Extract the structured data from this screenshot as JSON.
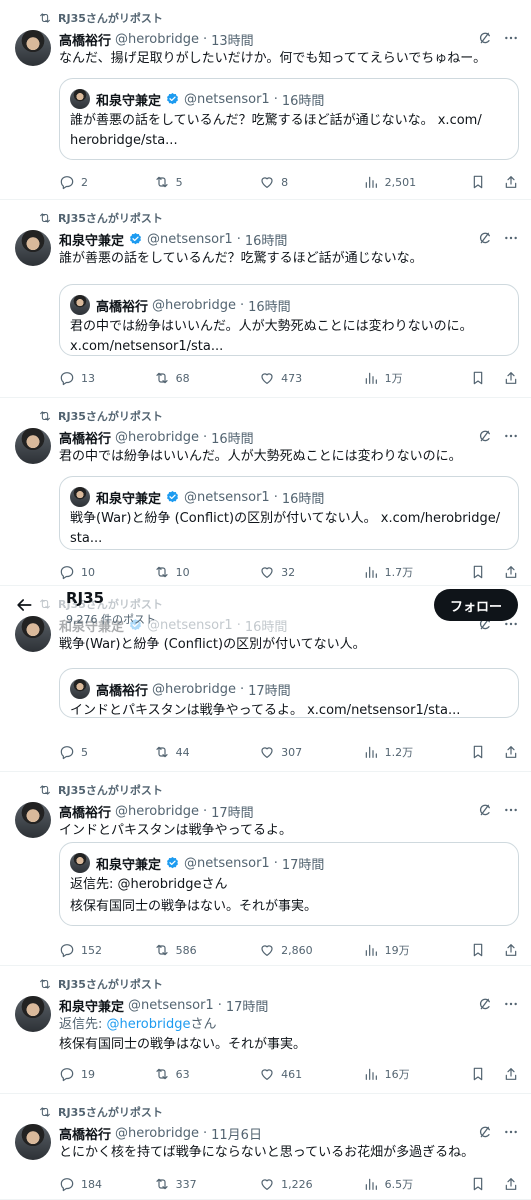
{
  "overlay": {
    "title": "RJ35",
    "post_count": "9,276 件のポスト",
    "follow_label": "フォロー"
  },
  "repost_label": "RJ35さんがリポスト",
  "tweets": [
    {
      "name": "高橋裕行",
      "handle": "@herobridge",
      "time": "13時間",
      "text": "なんだ、揚げ足取りがしたいだけか。何でも知っててえらいでちゅねー。",
      "quote": {
        "name": "和泉守兼定",
        "verified": true,
        "handle": "@netsensor1",
        "time": "16時間",
        "text1": "誰が善悪の話をしているんだ？吃驚するほど話が通じないな。 x.com/",
        "text2": "herobridge/sta..."
      },
      "replies": "2",
      "reposts": "5",
      "likes": "8",
      "views": "2,501"
    },
    {
      "name": "和泉守兼定",
      "verified": true,
      "handle": "@netsensor1",
      "time": "16時間",
      "text": "誰が善悪の話をしているんだ？吃驚するほど話が通じないな。",
      "quote": {
        "name": "高橋裕行",
        "handle": "@herobridge",
        "time": "16時間",
        "text1": "君の中では紛争はいいんだ。人が大勢死ぬことには変わりないのに。",
        "text2": "x.com/netsensor1/sta..."
      },
      "replies": "13",
      "reposts": "68",
      "likes": "473",
      "views": "1万"
    },
    {
      "name": "高橋裕行",
      "handle": "@herobridge",
      "time": "16時間",
      "text": "君の中では紛争はいいんだ。人が大勢死ぬことには変わりないのに。",
      "quote": {
        "name": "和泉守兼定",
        "verified": true,
        "handle": "@netsensor1",
        "time": "16時間",
        "text1": "戦争(War)と紛争 (Conflict)の区別が付いてない人。 x.com/herobridge/",
        "text2": "sta..."
      },
      "replies": "10",
      "reposts": "10",
      "likes": "32",
      "views": "1.7万"
    },
    {
      "name": "和泉守兼定",
      "verified": true,
      "handle": "@netsensor1",
      "time": "16時間",
      "text": "戦争(War)と紛争 (Conflict)の区別が付いてない人。",
      "quote": {
        "name": "高橋裕行",
        "handle": "@herobridge",
        "time": "17時間",
        "text1": "インドとパキスタンは戦争やってるよ。 x.com/netsensor1/sta..."
      },
      "replies": "5",
      "reposts": "44",
      "likes": "307",
      "views": "1.2万"
    },
    {
      "name": "高橋裕行",
      "handle": "@herobridge",
      "time": "17時間",
      "text": "インドとパキスタンは戦争やってるよ。",
      "quote": {
        "name": "和泉守兼定",
        "verified": true,
        "handle": "@netsensor1",
        "time": "17時間",
        "reply_prefix": "返信先: ",
        "reply_handle": "@herobridge",
        "reply_suffix": "さん",
        "text1": "核保有国同士の戦争はない。それが事実。"
      },
      "replies": "152",
      "reposts": "586",
      "likes": "2,860",
      "views": "19万"
    },
    {
      "name": "和泉守兼定",
      "verified": false,
      "handle": "@netsensor1",
      "time": "17時間",
      "reply_prefix": "返信先: ",
      "reply_handle": "@herobridge",
      "reply_suffix": "さん",
      "text": "核保有国同士の戦争はない。それが事実。",
      "replies": "19",
      "reposts": "63",
      "likes": "461",
      "views": "16万"
    },
    {
      "name": "高橋裕行",
      "handle": "@herobridge",
      "time": "11月6日",
      "text": "とにかく核を持てば戦争にならないと思っているお花畑が多過ぎるね。",
      "replies": "184",
      "reposts": "337",
      "likes": "1,226",
      "views": "6.5万"
    }
  ],
  "dot": "·",
  "colors": {
    "accent": "#1d9bf0",
    "text": "#0f1419",
    "muted": "#536471",
    "border": "#cfd9de"
  }
}
